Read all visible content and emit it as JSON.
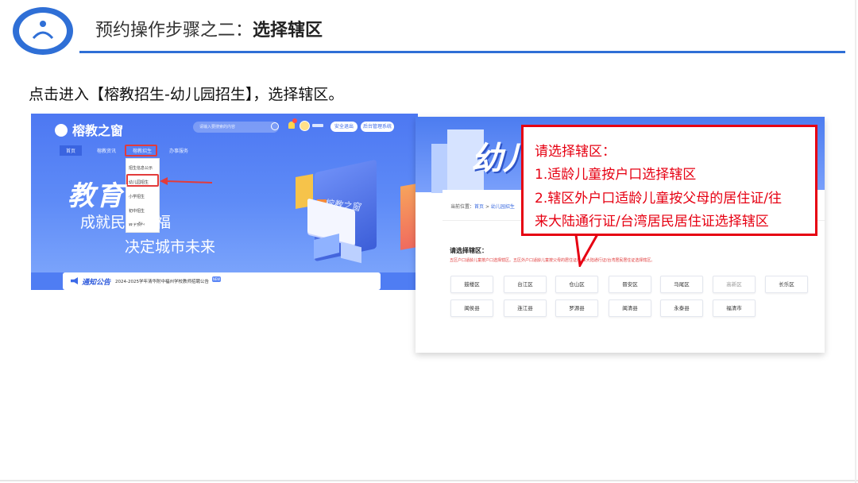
{
  "slide": {
    "title_prefix": "预约操作步骤之二：",
    "title_emphasis": "选择辖区",
    "instruction": "点击进入【榕教招生-幼儿园招生】，选择辖区。"
  },
  "portal": {
    "site_name": "榕教之窗",
    "search_placeholder": "请输入要搜索的内容",
    "buttons": [
      "安全退出",
      "后台管理系统"
    ],
    "nav": [
      "首页",
      "榕教资讯",
      "榕教招生",
      "办事服务"
    ],
    "active_nav": "首页",
    "dropdown": [
      "招生信息公示",
      "幼儿园招生",
      "小学招生",
      "初中招生",
      "转学预约"
    ],
    "highlighted_dropdown_item": "幼儿园招生",
    "hero_line1": "教育",
    "hero_line2": "成就民生幸福",
    "hero_line3": "决定城市未来",
    "hero_board_text": "榕教之窗",
    "notice_tag": "通知公告",
    "notice_text": "2024-2025学年清华附中福州学校教师招聘公告",
    "notice_badge": "NEW"
  },
  "district_page": {
    "banner_text": "幼儿",
    "breadcrumb_label": "当前位置：",
    "breadcrumb_home": "首页",
    "breadcrumb_sep": ">",
    "breadcrumb_current": "幼儿园招生",
    "heading": "请选择辖区：",
    "note": "五区户口适龄儿童按户口选择辖区。五区外户口适龄儿童按父母的居住证/往来大陆通行证/台湾居民居住证选择辖区。",
    "districts_row1": [
      "鼓楼区",
      "台江区",
      "仓山区",
      "晋安区",
      "马尾区",
      "高新区",
      "长乐区"
    ],
    "districts_row2": [
      "闽侯县",
      "连江县",
      "罗源县",
      "闽清县",
      "永泰县",
      "福清市"
    ]
  },
  "callout": {
    "line1": "请选择辖区：",
    "line2": "1.适龄儿童按户口选择辖区",
    "line3": "2.辖区外户口适龄儿童按父母的居住证/往",
    "line4": "来大陆通行证/台湾居民居住证选择辖区"
  },
  "colors": {
    "accent_blue": "#2f6fd6",
    "callout_red": "#e60012",
    "portal_blue": "#4f7df3"
  }
}
